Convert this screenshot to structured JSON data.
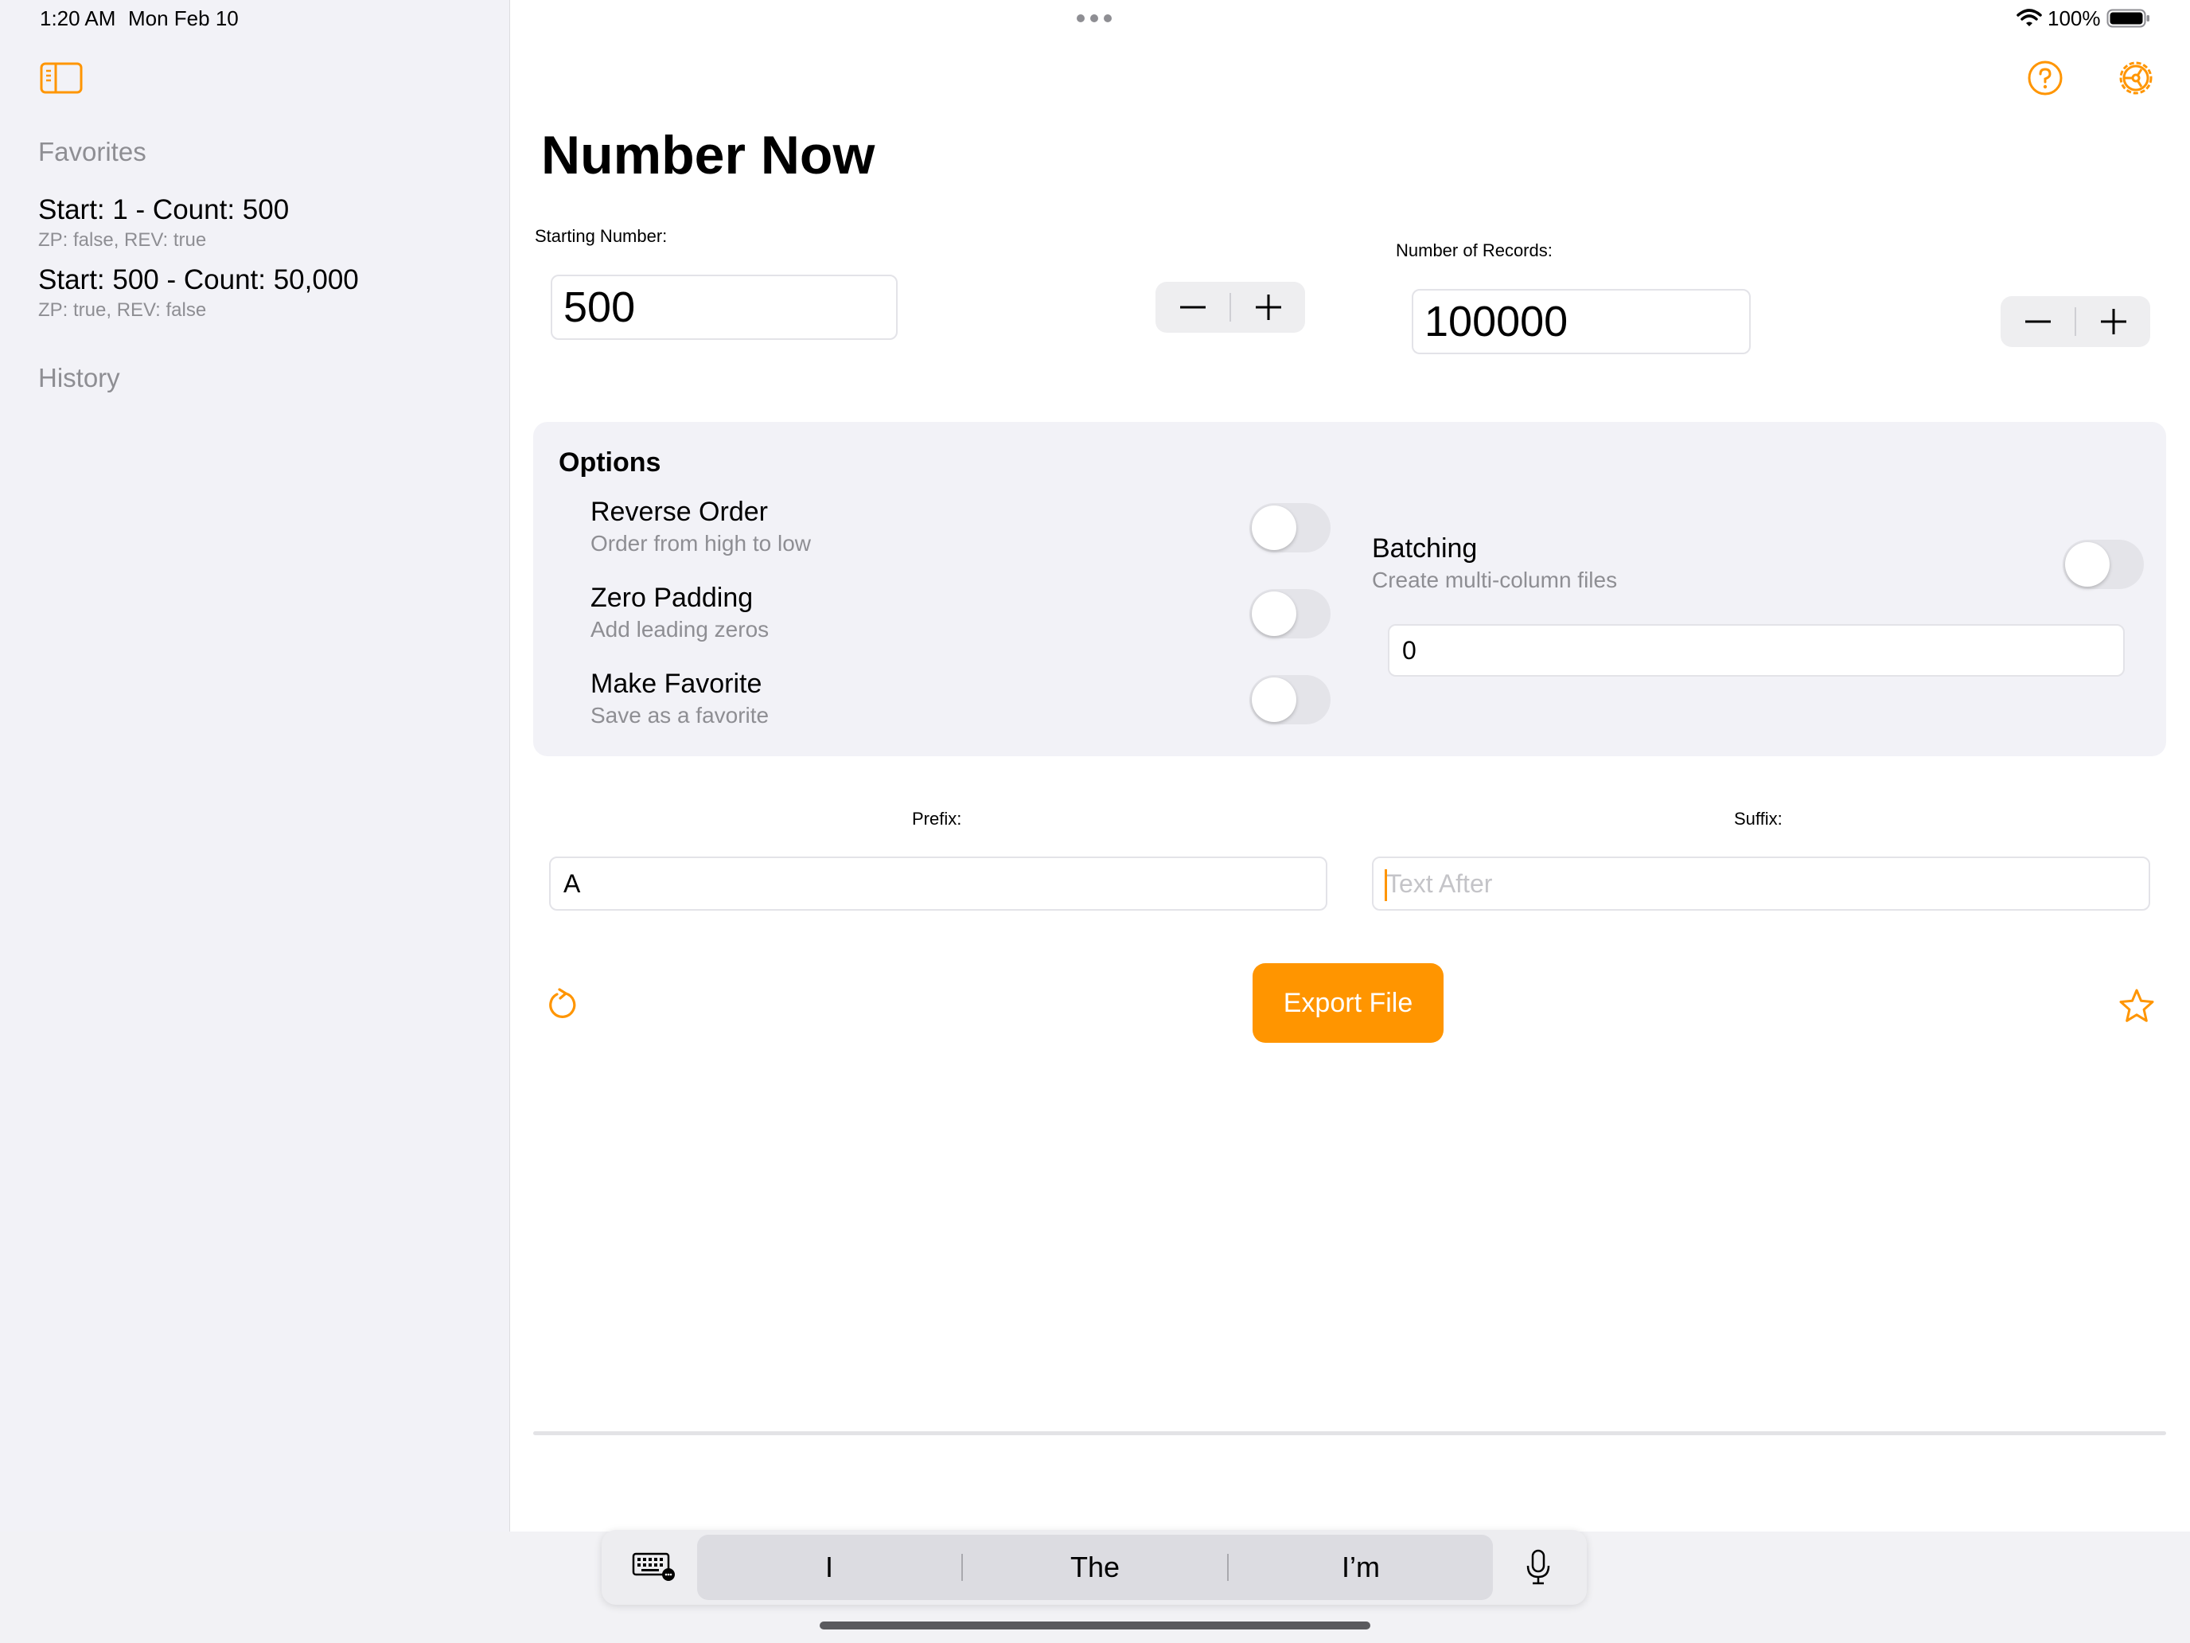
{
  "status_bar": {
    "time": "1:20 AM",
    "date": "Mon Feb 10",
    "battery": "100%"
  },
  "sidebar": {
    "favorites_heading": "Favorites",
    "favorites": [
      {
        "title": "Start: 1 - Count: 500",
        "detail": "ZP: false, REV: true"
      },
      {
        "title": "Start: 500 - Count: 50,000",
        "detail": "ZP: true, REV: false"
      }
    ],
    "history_heading": "History"
  },
  "header": {
    "title": "Number Now"
  },
  "starting_number": {
    "label": "Starting Number:",
    "value": "500"
  },
  "records": {
    "label": "Number of Records:",
    "value": "100000"
  },
  "stepper": {
    "minus": "−",
    "plus": "+"
  },
  "options": {
    "heading": "Options",
    "reverse": {
      "title": "Reverse Order",
      "subtitle": "Order from high to low",
      "on": false
    },
    "zero_padding": {
      "title": "Zero Padding",
      "subtitle": "Add leading zeros",
      "on": false
    },
    "favorite": {
      "title": "Make Favorite",
      "subtitle": "Save as a favorite",
      "on": false
    },
    "batching": {
      "title": "Batching",
      "subtitle": "Create multi-column files",
      "on": false,
      "value": "0"
    }
  },
  "prefix": {
    "label": "Prefix:",
    "value": "A"
  },
  "suffix": {
    "label": "Suffix:",
    "placeholder": "Text After"
  },
  "export_label": "Export File",
  "keyboard": {
    "suggestions": [
      "I",
      "The",
      "I’m"
    ]
  },
  "colors": {
    "accent": "#ff9500",
    "sidebar_bg": "#f2f2f7",
    "secondary_text": "#8e8e93"
  }
}
